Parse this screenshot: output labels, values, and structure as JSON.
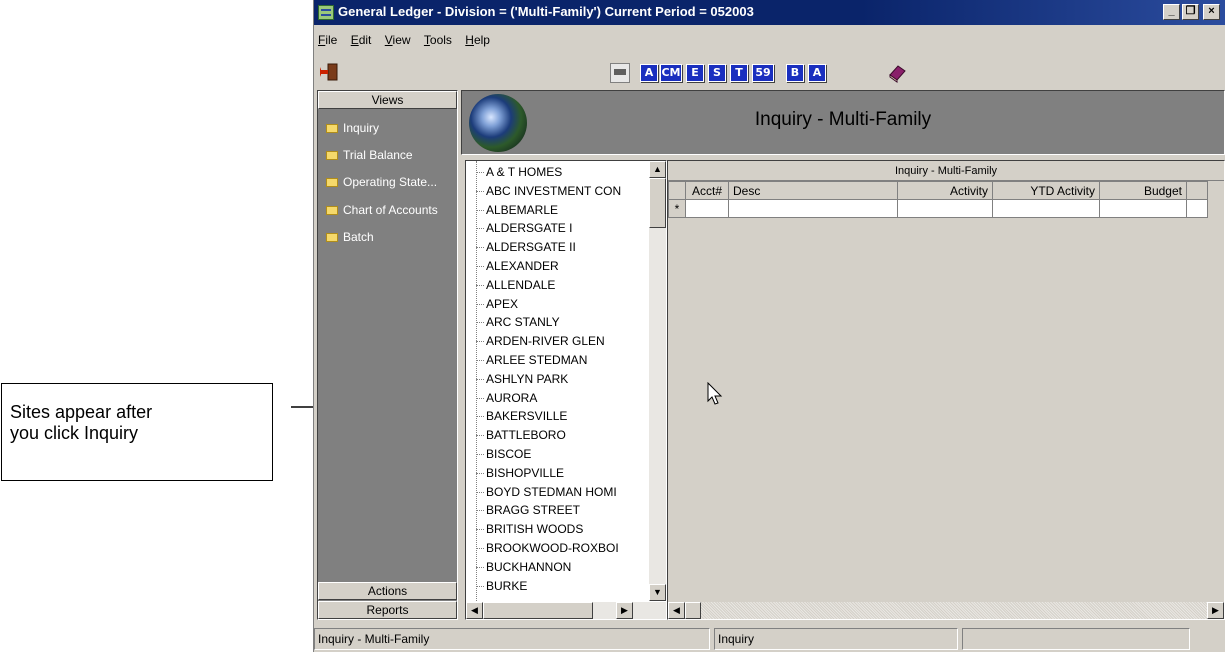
{
  "callout": {
    "line1": "Sites appear after",
    "line2": "you click Inquiry"
  },
  "window": {
    "title": "General Ledger - Division = ('Multi-Family') Current Period = 052003"
  },
  "menu": [
    "File",
    "Edit",
    "View",
    "Tools",
    "Help"
  ],
  "toolbar": {
    "buttons": [
      "A",
      "CM",
      "E",
      "S",
      "T",
      "59",
      "B",
      "A"
    ]
  },
  "nav": {
    "views_header": "Views",
    "items": [
      "Inquiry",
      "Trial Balance",
      "Operating State...",
      "Chart of Accounts",
      "Batch"
    ],
    "actions_label": "Actions",
    "reports_label": "Reports"
  },
  "main": {
    "title": "Inquiry - Multi-Family"
  },
  "sites": [
    "A & T HOMES",
    "ABC INVESTMENT CON",
    "ALBEMARLE",
    "ALDERSGATE I",
    "ALDERSGATE II",
    "ALEXANDER",
    "ALLENDALE",
    "APEX",
    "ARC STANLY",
    "ARDEN-RIVER GLEN",
    "ARLEE STEDMAN",
    "ASHLYN PARK",
    "AURORA",
    "BAKERSVILLE",
    "BATTLEBORO",
    "BISCOE",
    "BISHOPVILLE",
    "BOYD STEDMAN HOMI",
    "BRAGG STREET",
    "BRITISH WOODS",
    "BROOKWOOD-ROXBOI",
    "BUCKHANNON",
    "BURKE"
  ],
  "grid": {
    "caption": "Inquiry - Multi-Family",
    "columns": [
      "Acct#",
      "Desc",
      "Activity",
      "YTD Activity",
      "Budget"
    ],
    "new_row_marker": "*"
  },
  "status": {
    "left": "Inquiry - Multi-Family",
    "middle": "Inquiry",
    "right": ""
  },
  "colors": {
    "titlebar": "#0a246a",
    "toolbar_button": "#1a2fbf",
    "panel_gray": "#808080",
    "window_face": "#d4d0c8"
  }
}
